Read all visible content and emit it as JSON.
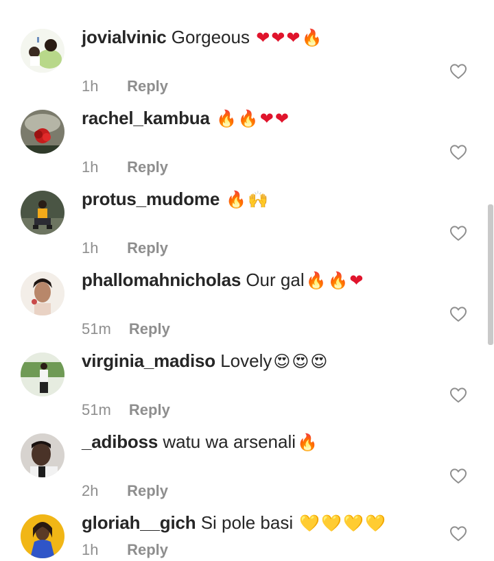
{
  "comments": [
    {
      "username": "jovialvinic",
      "text": "Gorgeous",
      "emoji": [
        {
          "char": "❤",
          "kind": "heart"
        },
        {
          "char": "❤",
          "kind": "heart"
        },
        {
          "char": "❤",
          "kind": "heart"
        },
        {
          "char": "🔥",
          "kind": "fire"
        }
      ],
      "time": "1h",
      "reply": "Reply",
      "avatar_color": "#a8c98a"
    },
    {
      "username": "rachel_kambua",
      "text": "",
      "emoji": [
        {
          "char": "🔥",
          "kind": "fire"
        },
        {
          "char": "🔥",
          "kind": "fire"
        },
        {
          "char": "❤",
          "kind": "heart"
        },
        {
          "char": "❤",
          "kind": "heart"
        }
      ],
      "time": "1h",
      "reply": "Reply",
      "avatar_color": "#6a6a5a"
    },
    {
      "username": "protus_mudome",
      "text": "",
      "emoji": [
        {
          "char": "🔥",
          "kind": "fire"
        },
        {
          "char": "🙌",
          "kind": "hands"
        }
      ],
      "time": "1h",
      "reply": "Reply",
      "avatar_color": "#3e4a3a"
    },
    {
      "username": "phallomahnicholas",
      "text": "Our gal",
      "emoji": [
        {
          "char": "🔥",
          "kind": "fire"
        },
        {
          "char": "🔥",
          "kind": "fire"
        },
        {
          "char": "❤",
          "kind": "heart"
        }
      ],
      "time": "51m",
      "reply": "Reply",
      "avatar_color": "#caa991"
    },
    {
      "username": "virginia_madiso",
      "text": "Lovely",
      "emoji": [
        {
          "char": "😍",
          "kind": "face"
        },
        {
          "char": "😍",
          "kind": "face"
        },
        {
          "char": "😍",
          "kind": "face"
        }
      ],
      "time": "51m",
      "reply": "Reply",
      "avatar_color": "#7fa36a"
    },
    {
      "username": "_adiboss",
      "text": "watu wa arsenali",
      "emoji": [
        {
          "char": "🔥",
          "kind": "fire"
        }
      ],
      "time": "2h",
      "reply": "Reply",
      "avatar_color": "#5a4a40"
    },
    {
      "username": "gloriah__gich",
      "text": "Si pole basi",
      "emoji": [
        {
          "char": "💛",
          "kind": "yellow"
        },
        {
          "char": "💛",
          "kind": "yellow"
        },
        {
          "char": "💛",
          "kind": "yellow"
        },
        {
          "char": "💛",
          "kind": "yellow"
        }
      ],
      "time": "1h",
      "reply": "Reply",
      "avatar_color": "#e8b21a"
    }
  ],
  "icons": {
    "like": "heart-outline-icon"
  },
  "colors": {
    "text": "#262626",
    "meta": "#8e8e8e",
    "heart": "#e0142c",
    "yellow_heart": "#f7c21b",
    "fire": "#f26b10"
  }
}
